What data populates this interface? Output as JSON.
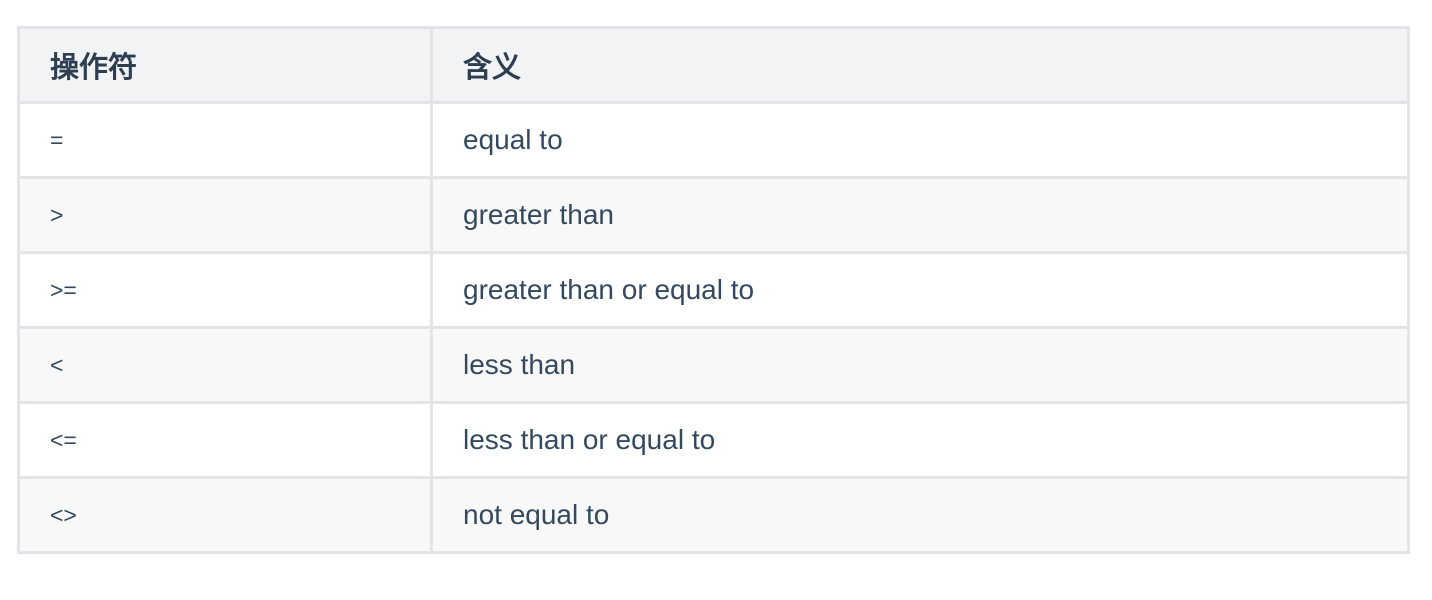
{
  "table": {
    "headers": [
      "操作符",
      "含义"
    ],
    "rows": [
      {
        "operator": "=",
        "meaning": "equal to"
      },
      {
        "operator": ">",
        "meaning": "greater than"
      },
      {
        "operator": ">=",
        "meaning": "greater than or equal to"
      },
      {
        "operator": "<",
        "meaning": "less than"
      },
      {
        "operator": "<=",
        "meaning": "less than or equal to"
      },
      {
        "operator": "<>",
        "meaning": "not equal to"
      }
    ]
  }
}
